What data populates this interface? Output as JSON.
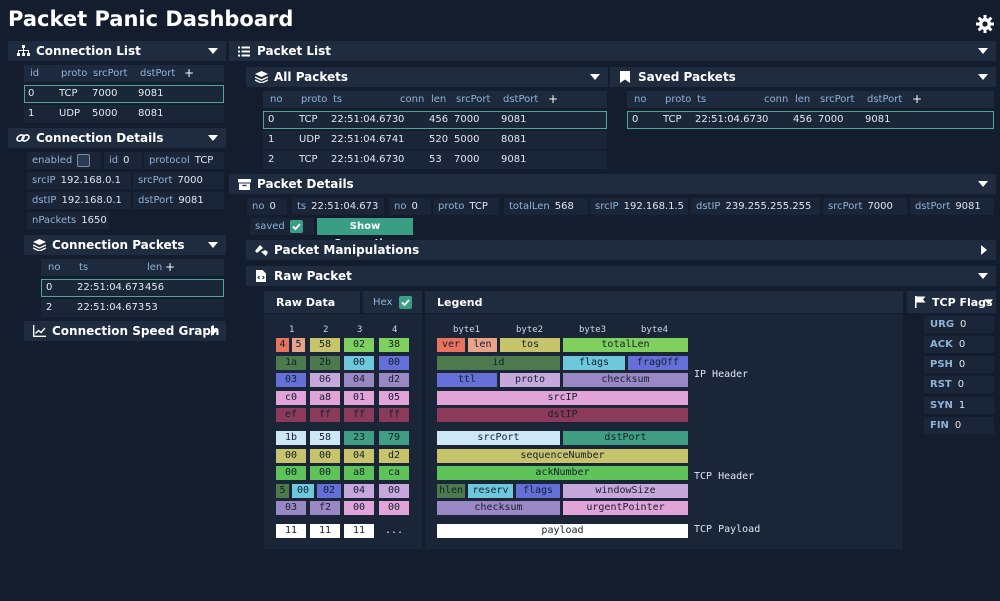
{
  "app": {
    "title": "Packet Panic Dashboard"
  },
  "colors": {
    "bg": "#141d2e",
    "header": "#1f2c40",
    "accent": "#3a9e84",
    "selection": "#4fa896"
  },
  "connection_list": {
    "title": "Connection List",
    "columns": [
      "id",
      "proto",
      "srcPort",
      "dstPort"
    ],
    "rows": [
      {
        "id": "0",
        "proto": "TCP",
        "srcPort": "7000",
        "dstPort": "9081"
      },
      {
        "id": "1",
        "proto": "UDP",
        "srcPort": "5000",
        "dstPort": "8081"
      }
    ]
  },
  "connection_details": {
    "title": "Connection Details",
    "enabled_label": "enabled",
    "id_label": "id",
    "id": "0",
    "protocol_label": "protocol",
    "protocol": "TCP",
    "srcIP_label": "srcIP",
    "srcIP": "192.168.0.1",
    "srcPort_label": "srcPort",
    "srcPort": "7000",
    "dstIP_label": "dstIP",
    "dstIP": "192.168.0.1",
    "dstPort_label": "dstPort",
    "dstPort": "9081",
    "nPackets_label": "nPackets",
    "nPackets": "1650"
  },
  "connection_packets": {
    "title": "Connection Packets",
    "columns": [
      "no",
      "ts",
      "len"
    ],
    "rows": [
      {
        "no": "0",
        "ts": "22:51:04.673",
        "len": "456"
      },
      {
        "no": "2",
        "ts": "22:51:04.673",
        "len": "53"
      }
    ]
  },
  "speed_graph": {
    "title": "Connection Speed Graph"
  },
  "packet_list": {
    "title": "Packet List",
    "all_packets": {
      "title": "All Packets",
      "columns": [
        "no",
        "proto",
        "ts",
        "conn",
        "len",
        "srcPort",
        "dstPort"
      ],
      "rows": [
        {
          "no": "0",
          "proto": "TCP",
          "ts": "22:51:04.673",
          "conn": "0",
          "len": "456",
          "srcPort": "7000",
          "dstPort": "9081"
        },
        {
          "no": "1",
          "proto": "UDP",
          "ts": "22:51:04.674",
          "conn": "1",
          "len": "520",
          "srcPort": "5000",
          "dstPort": "8081"
        },
        {
          "no": "2",
          "proto": "TCP",
          "ts": "22:51:04.673",
          "conn": "0",
          "len": "53",
          "srcPort": "7000",
          "dstPort": "9081"
        }
      ]
    },
    "saved_packets": {
      "title": "Saved Packets",
      "columns": [
        "no",
        "proto",
        "ts",
        "conn",
        "len",
        "srcPort",
        "dstPort"
      ],
      "rows": [
        {
          "no": "0",
          "proto": "TCP",
          "ts": "22:51:04.673",
          "conn": "0",
          "len": "456",
          "srcPort": "7000",
          "dstPort": "9081"
        }
      ]
    }
  },
  "packet_details": {
    "title": "Packet Details",
    "fields": [
      {
        "k": "no",
        "v": "0"
      },
      {
        "k": "ts",
        "v": "22:51:04.673"
      },
      {
        "k": "no",
        "v": "0"
      },
      {
        "k": "proto",
        "v": "TCP"
      },
      {
        "k": "totalLen",
        "v": "568"
      },
      {
        "k": "srcIP",
        "v": "192.168.1.5"
      },
      {
        "k": "dstIP",
        "v": "239.255.255.255"
      },
      {
        "k": "srcPort",
        "v": "7000"
      },
      {
        "k": "dstPort",
        "v": "9081"
      }
    ],
    "saved_label": "saved",
    "show_connection": "Show Connection"
  },
  "packet_manipulations": {
    "title": "Packet Manipulations"
  },
  "raw_packet": {
    "title": "Raw Packet",
    "raw_data": "Raw Data",
    "hex_label": "Hex",
    "legend": "Legend",
    "col_headers": [
      "1",
      "2",
      "3",
      "4"
    ],
    "byte_headers": [
      "byte1",
      "byte2",
      "byte3",
      "byte4"
    ],
    "hex_rows": [
      [
        "4",
        "5",
        "58",
        "02",
        "38"
      ],
      [
        "1a",
        "2b",
        "00",
        "00"
      ],
      [
        "03",
        "06",
        "04",
        "d2"
      ],
      [
        "c0",
        "a8",
        "01",
        "05"
      ],
      [
        "ef",
        "ff",
        "ff",
        "ff"
      ],
      [
        "1b",
        "58",
        "23",
        "79"
      ],
      [
        "00",
        "00",
        "04",
        "d2"
      ],
      [
        "00",
        "00",
        "a8",
        "ca"
      ],
      [
        "5",
        "00",
        "02",
        "04",
        "00"
      ],
      [
        "03",
        "f2",
        "00",
        "00"
      ],
      [
        "11",
        "11",
        "11",
        "..."
      ]
    ],
    "legend_fields": {
      "ver": "ver",
      "len": "len",
      "tos": "tos",
      "totalLen": "totalLen",
      "id": "id",
      "flags": "flags",
      "fragOff": "fragOff",
      "ttl": "ttl",
      "proto": "proto",
      "checksum": "checksum",
      "srcIP": "srcIP",
      "dstIP": "dstIP",
      "srcPort": "srcPort",
      "dstPort": "dstPort",
      "sequenceNumber": "sequenceNumber",
      "ackNumber": "ackNumber",
      "hlen": "hlen",
      "reserv": "reserv",
      "tflags": "flags",
      "windowSize": "windowSize",
      "tchecksum": "checksum",
      "urgentPointer": "urgentPointer",
      "payload": "payload"
    },
    "section_labels": {
      "ip": "IP Header",
      "tcp": "TCP Header",
      "payload": "TCP Payload"
    }
  },
  "tcp_flags": {
    "title": "TCP Flags",
    "flags": [
      {
        "k": "URG",
        "v": "0"
      },
      {
        "k": "ACK",
        "v": "0"
      },
      {
        "k": "PSH",
        "v": "0"
      },
      {
        "k": "RST",
        "v": "0"
      },
      {
        "k": "SYN",
        "v": "1"
      },
      {
        "k": "FIN",
        "v": "0"
      }
    ]
  }
}
